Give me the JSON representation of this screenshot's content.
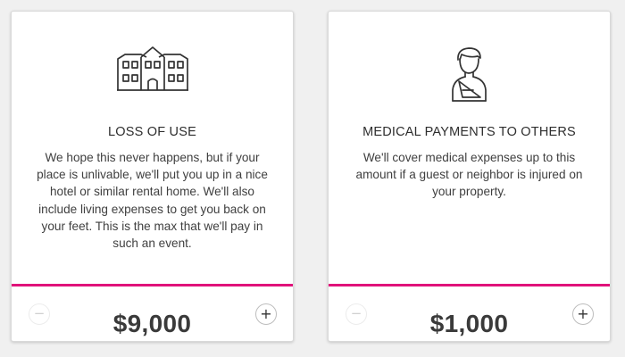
{
  "cards": [
    {
      "icon": "building-icon",
      "title": "LOSS OF USE",
      "description": "We hope this never happens, but if your place is unlivable, we'll put you up in a nice hotel or similar rental home. We'll also include living expenses to get you back on your feet. This is the max that we'll pay in such an event.",
      "amount": "$9,000",
      "decrease_label": "−",
      "increase_label": "+"
    },
    {
      "icon": "injured-person-icon",
      "title": "MEDICAL PAYMENTS TO OTHERS",
      "description": "We'll cover medical expenses up to this amount if a guest or neighbor is injured on your property.",
      "amount": "$1,000",
      "decrease_label": "−",
      "increase_label": "+"
    }
  ],
  "colors": {
    "accent": "#e0127a",
    "card_background": "#ffffff",
    "page_background": "#f0f0f0"
  }
}
